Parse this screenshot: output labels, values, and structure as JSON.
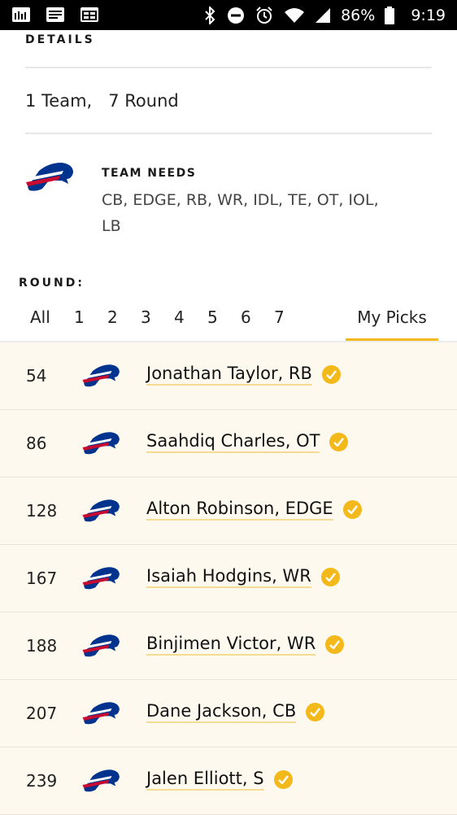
{
  "status_bar": {
    "battery_pct": "86%",
    "time": "9:19"
  },
  "details": {
    "label": "DETAILS",
    "summary": "1 Team,   7 Round"
  },
  "team_needs": {
    "label": "TEAM NEEDS",
    "text": "CB, EDGE, RB, WR, IDL, TE, OT, IOL, LB"
  },
  "round": {
    "label": "ROUND:",
    "tabs": [
      "All",
      "1",
      "2",
      "3",
      "4",
      "5",
      "6",
      "7"
    ],
    "my_picks": "My Picks",
    "active_tab": "My Picks"
  },
  "picks": [
    {
      "number": "54",
      "player": "Jonathan Taylor, RB"
    },
    {
      "number": "86",
      "player": "Saahdiq Charles, OT"
    },
    {
      "number": "128",
      "player": "Alton Robinson, EDGE"
    },
    {
      "number": "167",
      "player": "Isaiah Hodgins, WR"
    },
    {
      "number": "188",
      "player": "Binjimen Victor, WR"
    },
    {
      "number": "207",
      "player": "Dane Jackson, CB"
    },
    {
      "number": "239",
      "player": "Jalen Elliott, S"
    }
  ],
  "colors": {
    "accent": "#f3b81a",
    "row_bg": "#fdf9ee",
    "logo_blue": "#00338d",
    "logo_red": "#c60c30"
  },
  "icons": [
    "team-logo-icon",
    "checkmark-icon"
  ]
}
